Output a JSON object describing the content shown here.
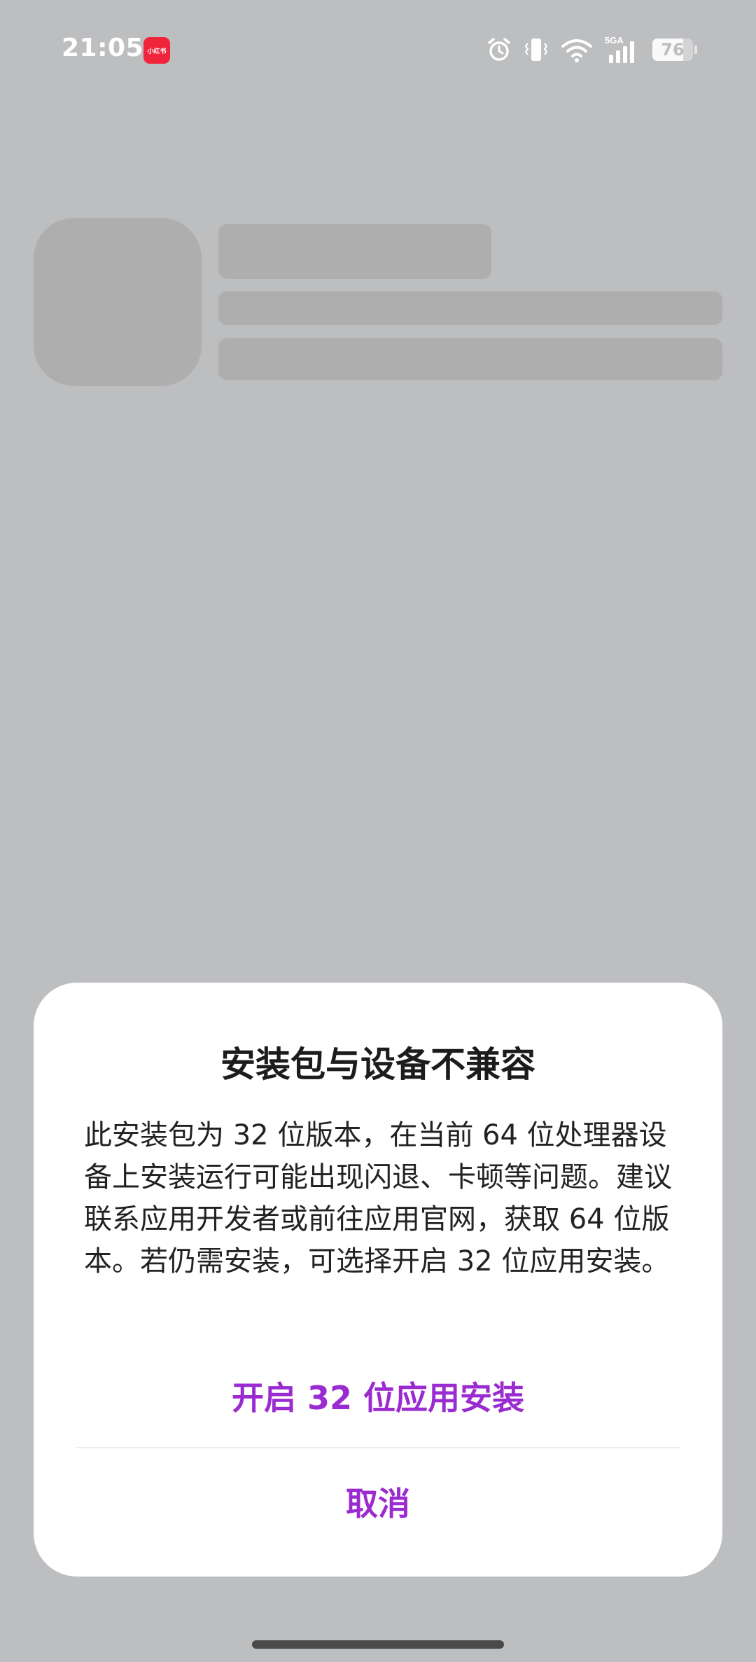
{
  "status_bar": {
    "time": "21:05",
    "app_icon_label": "小红书",
    "network_label": "5GA",
    "battery_level": "76",
    "icons": [
      "alarm-icon",
      "vibrate-icon",
      "wifi-icon",
      "signal-icon",
      "battery-icon"
    ]
  },
  "dialog": {
    "title": "安装包与设备不兼容",
    "message": "此安装包为 32 位版本，在当前 64 位处理器设备上安装运行可能出现闪退、卡顿等问题。建议联系应用开发者或前往应用官网，获取 64 位版本。若仍需安装，可选择开启 32 位应用安装。",
    "primary_action": "开启 32 位应用安装",
    "cancel_action": "取消"
  },
  "colors": {
    "background": "#bdbec0",
    "accent": "#9a2bd0",
    "skeleton": "#aeaeae",
    "dialog_bg": "#ffffff"
  }
}
